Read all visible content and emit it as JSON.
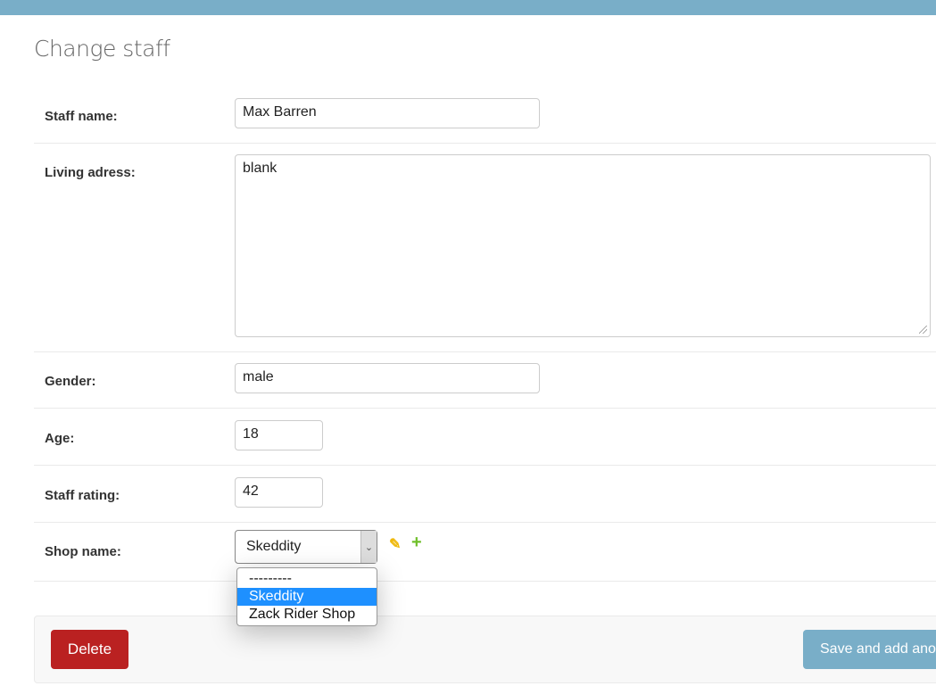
{
  "header": {
    "title": "Change staff"
  },
  "form": {
    "staff_name": {
      "label": "Staff name:",
      "value": "Max Barren"
    },
    "living_address": {
      "label": "Living adress:",
      "value": "blank"
    },
    "gender": {
      "label": "Gender:",
      "value": "male"
    },
    "age": {
      "label": "Age:",
      "value": "18"
    },
    "staff_rating": {
      "label": "Staff rating:",
      "value": "42"
    },
    "shop_name": {
      "label": "Shop name:",
      "value": "Skeddity",
      "options": [
        "---------",
        "Skeddity",
        "Zack Rider Shop"
      ],
      "selected_index": 1,
      "edit_icon": "pencil-icon",
      "add_icon": "plus-icon"
    }
  },
  "actions": {
    "delete_label": "Delete",
    "save_add_label": "Save and add another"
  },
  "colors": {
    "header_bar": "#79aec8",
    "delete": "#ba2121",
    "primary": "#79aec8",
    "dropdown_highlight": "#1e90ff",
    "edit_icon": "#efb80b",
    "add_icon": "#70bf2b"
  }
}
